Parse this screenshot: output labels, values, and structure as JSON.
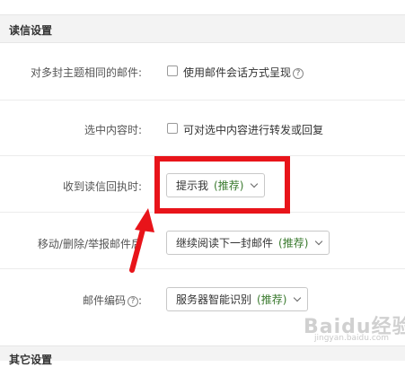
{
  "section_title": "读信设置",
  "rows": {
    "thread": {
      "label": "对多封主题相同的邮件:",
      "checkbox_text": "使用邮件会话方式呈现",
      "help": "?"
    },
    "selected_content": {
      "label": "选中内容时:",
      "checkbox_text": "可对选中内容进行转发或回复"
    },
    "read_receipt": {
      "label": "收到读信回执时:",
      "value": "提示我",
      "recommended": "(推荐)"
    },
    "after_move": {
      "label": "移动/删除/举报邮件后",
      "value": "继续阅读下一封邮件",
      "recommended": "(推荐)"
    },
    "encoding": {
      "label": "邮件编码",
      "help": "?",
      "label_suffix": ":",
      "value": "服务器智能识别",
      "recommended": "(推荐)"
    }
  },
  "next_section_title": "其它设置",
  "watermark": {
    "text": "Baidu经验",
    "sub": "jingyan.baidu.com"
  },
  "colors": {
    "highlight": "#e8141a",
    "recommended": "#3a7a2e",
    "header_bg": "#f3f3f3"
  }
}
